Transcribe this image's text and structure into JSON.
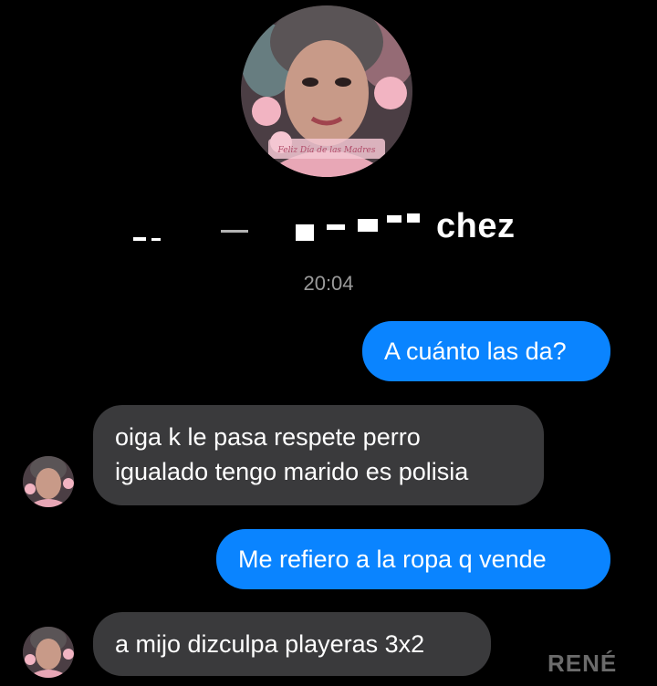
{
  "contact": {
    "name_visible": "chez",
    "time": "20:04"
  },
  "avatar": {
    "caption": "Feliz Día de las Madres"
  },
  "messages": [
    {
      "direction": "sent",
      "text": "A cuánto las da?"
    },
    {
      "direction": "received",
      "lines": [
        "oiga k le pasa respete perro",
        "igualado tengo marido es polisia"
      ]
    },
    {
      "direction": "sent",
      "text": "Me refiero a la ropa q vende"
    },
    {
      "direction": "received",
      "text": "a mijo dizculpa playeras 3x2"
    }
  ],
  "watermark": "RENÉ",
  "colors": {
    "background": "#000000",
    "sent_bubble": "#0a84ff",
    "received_bubble": "#3a3a3c",
    "timestamp": "#9a9a9a"
  }
}
